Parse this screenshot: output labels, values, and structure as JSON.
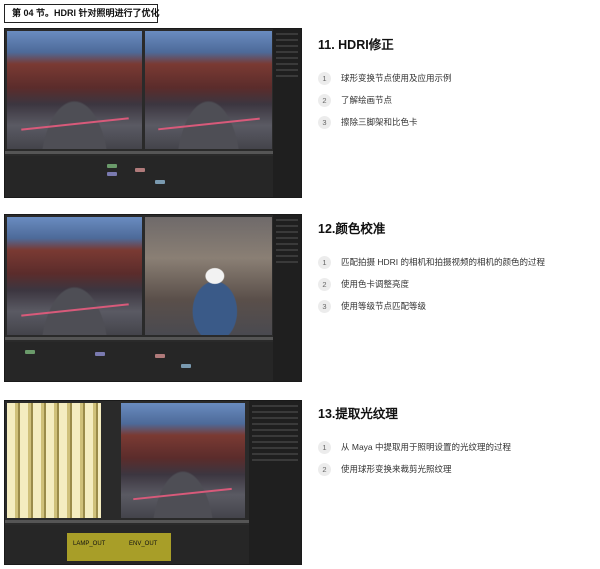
{
  "section_tag": "第 04 节。HDRI 针对照明进行了优化",
  "lessons": [
    {
      "title": "11. HDRI修正",
      "items": [
        {
          "num": "1",
          "text": "球形变换节点使用及应用示例"
        },
        {
          "num": "2",
          "text": "了解绘画节点"
        },
        {
          "num": "3",
          "text": "擦除三脚架和比色卡"
        }
      ]
    },
    {
      "title": "12.颜色校准",
      "items": [
        {
          "num": "1",
          "text": "匹配拍摄 HDRI 的相机和拍摄视频的相机的颜色的过程"
        },
        {
          "num": "2",
          "text": "使用色卡调整亮度"
        },
        {
          "num": "3",
          "text": "使用等级节点匹配等级"
        }
      ]
    },
    {
      "title": "13.提取光纹理",
      "items": [
        {
          "num": "1",
          "text": "从 Maya 中提取用于照明设置的光纹理的过程"
        },
        {
          "num": "2",
          "text": "使用球形变换来裁剪光照纹理"
        }
      ]
    }
  ],
  "node_labels": {
    "lamp_out": "LAMP_OUT",
    "env_out": "ENV_OUT"
  },
  "colors": {
    "badge_bg": "#ececec",
    "node_yellow": "#a89e28",
    "app_bg": "#2a2a2a"
  }
}
